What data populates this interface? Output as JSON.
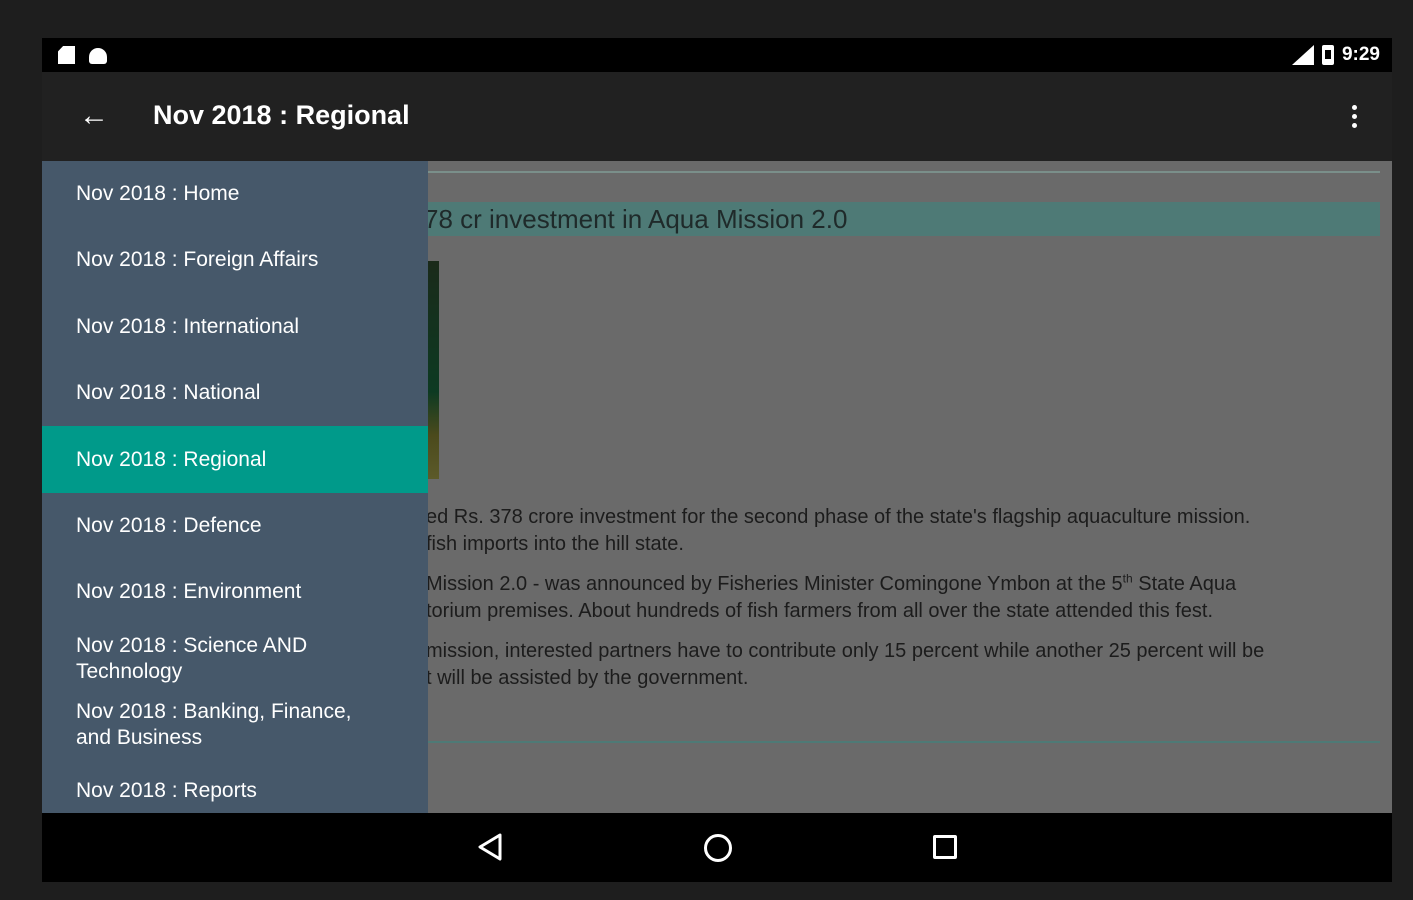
{
  "status_bar": {
    "time": "9:29",
    "icons": [
      "sd-card-icon",
      "android-icon",
      "signal-icon",
      "battery-icon"
    ]
  },
  "app_bar": {
    "title": "Nov 2018 : Regional",
    "back_icon": "arrow-left-icon",
    "menu_icon": "more-vert-icon"
  },
  "article": {
    "headline": "78 cr investment in Aqua Mission 2.0",
    "p1_line1": "ed Rs. 378 crore investment for the second phase of the state's flagship aquaculture mission.",
    "p1_line2": "fish imports into the hill state.",
    "p2_line1_a": "Mission 2.0 - was announced by Fisheries Minister Comingone Ymbon at the 5",
    "p2_line1_sup": "th",
    "p2_line1_b": " State Aqua",
    "p2_line2": "torium premises. About hundreds of fish farmers from all over the state attended this fest.",
    "p3_line1": "mission, interested partners have to contribute only 15 percent while another 25 percent will be",
    "p3_line2": "t will be assisted by the government."
  },
  "drawer": {
    "items": [
      {
        "label": "Nov 2018 : Home"
      },
      {
        "label": "Nov 2018 : Foreign Affairs"
      },
      {
        "label": "Nov 2018 : International"
      },
      {
        "label": "Nov 2018 : National"
      },
      {
        "label": "Nov 2018 : Regional",
        "active": true
      },
      {
        "label": "Nov 2018 : Defence"
      },
      {
        "label": "Nov 2018 : Environment"
      },
      {
        "label": "Nov 2018 : Science AND Technology"
      },
      {
        "label": "Nov 2018 : Banking, Finance, and Business"
      },
      {
        "label": "Nov 2018 : Reports"
      }
    ]
  },
  "nav_bar": {
    "icons": [
      "nav-back-icon",
      "nav-home-icon",
      "nav-recents-icon"
    ]
  },
  "colors": {
    "accent": "#009a8a",
    "drawer": "#46586a",
    "app_bar": "#212121"
  }
}
